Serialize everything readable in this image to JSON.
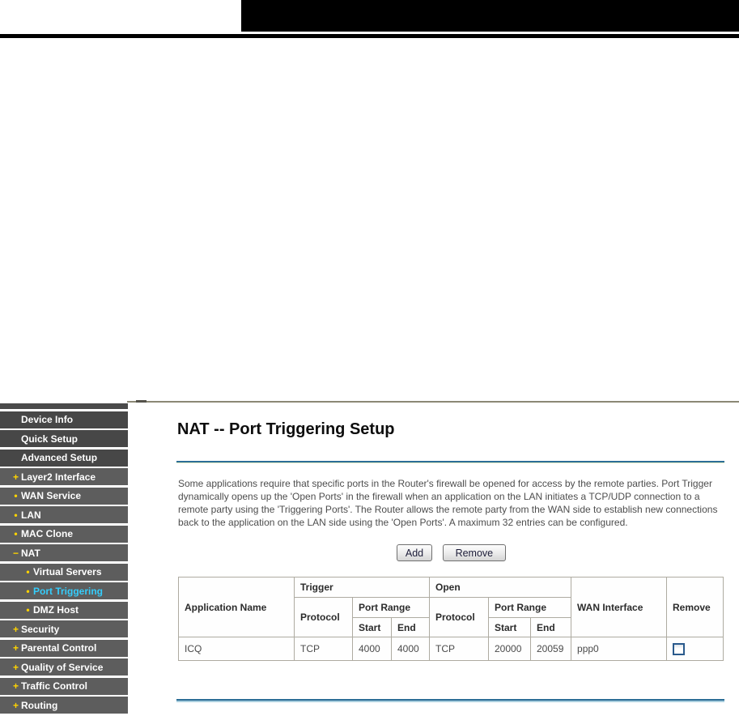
{
  "colors": {
    "banner": "#000000",
    "sidebar_item": "#5d5d5d",
    "sidebar_item_top_level": "#474747",
    "marker_yellow": "#ffd400",
    "active_cyan": "#35cdfc",
    "divider_blue": "#2c6e97",
    "table_border": "#aeaba1"
  },
  "sidebar": {
    "items": [
      {
        "label": "Device Info",
        "level": 1,
        "marker": ""
      },
      {
        "label": "Quick Setup",
        "level": 1,
        "marker": ""
      },
      {
        "label": "Advanced Setup",
        "level": 1,
        "marker": ""
      },
      {
        "label": "Layer2 Interface",
        "level": 2,
        "marker": "+"
      },
      {
        "label": "WAN Service",
        "level": 2,
        "marker": "•"
      },
      {
        "label": "LAN",
        "level": 2,
        "marker": "•"
      },
      {
        "label": "MAC Clone",
        "level": 2,
        "marker": "•"
      },
      {
        "label": "NAT",
        "level": 2,
        "marker": "−"
      },
      {
        "label": "Virtual Servers",
        "level": 3,
        "marker": "•"
      },
      {
        "label": "Port Triggering",
        "level": 3,
        "marker": "•",
        "active": true
      },
      {
        "label": "DMZ Host",
        "level": 3,
        "marker": "•"
      },
      {
        "label": "Security",
        "level": 2,
        "marker": "+"
      },
      {
        "label": "Parental Control",
        "level": 2,
        "marker": "+"
      },
      {
        "label": "Quality of Service",
        "level": 2,
        "marker": "+"
      },
      {
        "label": "Traffic Control",
        "level": 2,
        "marker": "+"
      },
      {
        "label": "Routing",
        "level": 2,
        "marker": "+"
      }
    ]
  },
  "main": {
    "title": "NAT -- Port Triggering Setup",
    "description": "Some applications require that specific ports in the Router's firewall be opened for access by the remote parties. Port Trigger dynamically opens up the 'Open Ports' in the firewall when an application on the LAN initiates a TCP/UDP connection to a remote party using the 'Triggering Ports'. The Router allows the remote party from the WAN side to establish new connections back to the application on the LAN side using the 'Open Ports'. A maximum 32 entries can be configured.",
    "buttons": {
      "add": "Add",
      "remove": "Remove"
    },
    "table": {
      "headers": {
        "application_name": "Application Name",
        "trigger": "Trigger",
        "open": "Open",
        "protocol": "Protocol",
        "port_range": "Port Range",
        "start": "Start",
        "end": "End",
        "wan_interface": "WAN Interface",
        "remove": "Remove"
      },
      "rows": [
        {
          "application_name": "ICQ",
          "trigger_protocol": "TCP",
          "trigger_start": "4000",
          "trigger_end": "4000",
          "open_protocol": "TCP",
          "open_start": "20000",
          "open_end": "20059",
          "wan_interface": "ppp0",
          "remove_checked": false
        }
      ]
    }
  }
}
